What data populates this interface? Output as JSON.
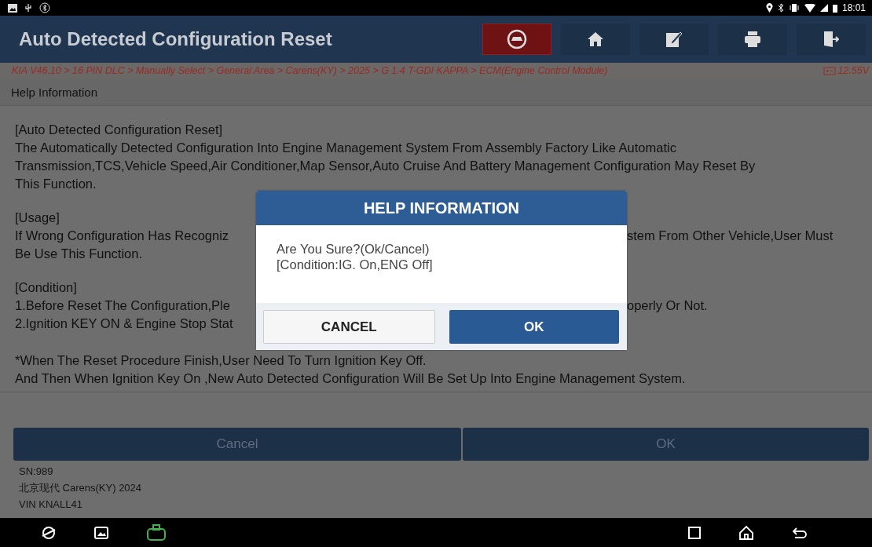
{
  "status_bar": {
    "time": "18:01"
  },
  "header": {
    "title": "Auto Detected Configuration Reset"
  },
  "breadcrumb": {
    "path": "KIA V46.10 > 16 PIN DLC > Manually Select > General Area > Carens(KY) > 2025 > G 1.4 T-GDI KAPPA > ECM(Engine Control Module)",
    "voltage": "12.55V"
  },
  "section_title": "Help Information",
  "help_paragraphs": [
    [
      {
        "left": "[Auto Detected Configuration Reset]"
      },
      {
        "left": "The Automatically Detected Configuration Into Engine Management System From Assembly Factory Like Automatic"
      },
      {
        "left": "Transmission,TCS,Vehicle Speed,Air Conditioner,Map Sensor,Auto Cruise And Battery Management Configuration May Reset By"
      },
      {
        "left": "This Function."
      }
    ],
    [
      {
        "left": "[Usage]"
      },
      {
        "left": "If Wrong Configuration Has Recogniz",
        "right": "stem From Other Vehicle,User Must"
      },
      {
        "left": "Be Use This Function."
      }
    ],
    [
      {
        "left": "[Condition]"
      },
      {
        "left": "1.Before Reset The Configuration,Ple",
        "right": "operly Or Not."
      },
      {
        "left": "2.Ignition KEY ON & Engine Stop Stat"
      }
    ],
    [
      {
        "left": "*When The Reset Procedure Finish,User Need To Turn Ignition Key Off."
      },
      {
        "left": "And Then When Ignition Key On ,New Auto Detected Configuration Will Be Set Up Into Engine Management System."
      }
    ]
  ],
  "bottom_buttons": [
    "Cancel",
    "OK"
  ],
  "vehicle_info": [
    "SN:989",
    "北京现代 Carens(KY) 2024",
    "VIN KNALL41"
  ],
  "dialog": {
    "title": "HELP INFORMATION",
    "message": [
      "Are You Sure?(Ok/Cancel)",
      "[Condition:IG. On,ENG Off]"
    ],
    "cancel": "CANCEL",
    "ok": "OK"
  }
}
